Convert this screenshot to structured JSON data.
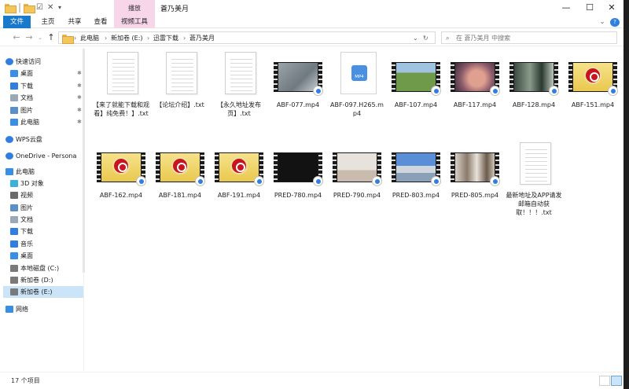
{
  "titlebar": {
    "window_title": "蒼乃美月",
    "context_tab_header": "播放",
    "minimize": "—",
    "maximize": "☐",
    "close": "✕"
  },
  "ribbon": {
    "tabs": [
      "文件",
      "主页",
      "共享",
      "查看",
      "视频工具"
    ]
  },
  "address": {
    "breadcrumbs": [
      "此电脑",
      "新加卷 (E:)",
      "迅雷下载",
      "蒼乃美月"
    ],
    "search_placeholder": "在 蒼乃美月 中搜索"
  },
  "nav": {
    "items": [
      {
        "label": "快速访问",
        "icon": "star-icon",
        "pinned": false
      },
      {
        "label": "桌面",
        "icon": "desktop-icon",
        "pinned": true
      },
      {
        "label": "下载",
        "icon": "download-icon",
        "pinned": true
      },
      {
        "label": "文档",
        "icon": "document-icon",
        "pinned": true
      },
      {
        "label": "图片",
        "icon": "picture-icon",
        "pinned": true
      },
      {
        "label": "此电脑",
        "icon": "computer-icon",
        "pinned": true
      },
      {
        "label": "WPS云盘",
        "icon": "cloud-icon",
        "pinned": false
      },
      {
        "label": "OneDrive - Persona",
        "icon": "cloud-icon",
        "pinned": false
      },
      {
        "label": "此电脑",
        "icon": "computer-icon",
        "pinned": false
      },
      {
        "label": "3D 对象",
        "icon": "cube-icon",
        "pinned": false
      },
      {
        "label": "视频",
        "icon": "video-icon",
        "pinned": false
      },
      {
        "label": "图片",
        "icon": "picture-icon",
        "pinned": false
      },
      {
        "label": "文档",
        "icon": "document-icon",
        "pinned": false
      },
      {
        "label": "下载",
        "icon": "download-icon",
        "pinned": false
      },
      {
        "label": "音乐",
        "icon": "music-icon",
        "pinned": false
      },
      {
        "label": "桌面",
        "icon": "desktop-icon",
        "pinned": false
      },
      {
        "label": "本地磁盘 (C:)",
        "icon": "drive-icon",
        "pinned": false
      },
      {
        "label": "新加卷 (D:)",
        "icon": "drive-icon",
        "pinned": false
      },
      {
        "label": "新加卷 (E:)",
        "icon": "drive-icon",
        "pinned": false,
        "selected": true
      },
      {
        "label": "网络",
        "icon": "network-icon",
        "pinned": false
      }
    ]
  },
  "files": [
    {
      "name": "【来了就能下载和观看】纯免费！】.txt",
      "kind": "txt"
    },
    {
      "name": "【论坛介绍】.txt",
      "kind": "txt"
    },
    {
      "name": "【永久地址发布页】.txt",
      "kind": "txt"
    },
    {
      "name": "ABF-077.mp4",
      "kind": "video",
      "thumb": "gray"
    },
    {
      "name": "ABF-097.H265.mp4",
      "kind": "mp4",
      "badge": "MP4"
    },
    {
      "name": "ABF-107.mp4",
      "kind": "video",
      "thumb": "green"
    },
    {
      "name": "ABF-117.mp4",
      "kind": "video",
      "thumb": "skin"
    },
    {
      "name": "ABF-128.mp4",
      "kind": "video",
      "thumb": "dark"
    },
    {
      "name": "ABF-151.mp4",
      "kind": "video",
      "thumb": "logo"
    },
    {
      "name": "ABF-162.mp4",
      "kind": "video",
      "thumb": "logo"
    },
    {
      "name": "ABF-181.mp4",
      "kind": "video",
      "thumb": "logo"
    },
    {
      "name": "ABF-191.mp4",
      "kind": "video",
      "thumb": "logo"
    },
    {
      "name": "PRED-780.mp4",
      "kind": "video",
      "thumb": "black"
    },
    {
      "name": "PRED-790.mp4",
      "kind": "video",
      "thumb": "room"
    },
    {
      "name": "PRED-803.mp4",
      "kind": "video",
      "thumb": "city"
    },
    {
      "name": "PRED-805.mp4",
      "kind": "video",
      "thumb": "people"
    },
    {
      "name": "最新地址及APP请发邮箱自动获取！！！.txt",
      "kind": "txt"
    }
  ],
  "status": {
    "item_count": "17 个项目"
  },
  "colors": {
    "file_tab": "#1979ca",
    "context_tab": "#f7d6ea",
    "selection": "#cce4f7",
    "logo_red": "#c8141e"
  }
}
